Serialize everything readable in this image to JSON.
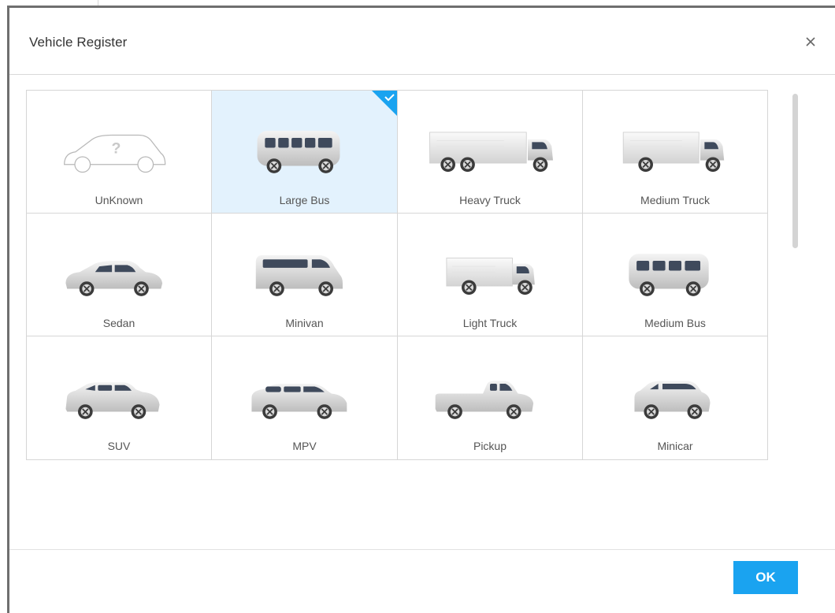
{
  "dialog": {
    "title": "Vehicle Register",
    "close_icon": "close-icon",
    "ok_label": "OK",
    "accent": "#1aa3f0",
    "selected_bg": "#e3f2fd"
  },
  "vehicles": [
    {
      "label": "UnKnown",
      "icon": "unknown-car-icon",
      "selected": false
    },
    {
      "label": "Large Bus",
      "icon": "large-bus-icon",
      "selected": true
    },
    {
      "label": "Heavy Truck",
      "icon": "heavy-truck-icon",
      "selected": false
    },
    {
      "label": "Medium Truck",
      "icon": "medium-truck-icon",
      "selected": false
    },
    {
      "label": "Sedan",
      "icon": "sedan-icon",
      "selected": false
    },
    {
      "label": "Minivan",
      "icon": "minivan-icon",
      "selected": false
    },
    {
      "label": "Light Truck",
      "icon": "light-truck-icon",
      "selected": false
    },
    {
      "label": "Medium Bus",
      "icon": "medium-bus-icon",
      "selected": false
    },
    {
      "label": "SUV",
      "icon": "suv-icon",
      "selected": false
    },
    {
      "label": "MPV",
      "icon": "mpv-icon",
      "selected": false
    },
    {
      "label": "Pickup",
      "icon": "pickup-icon",
      "selected": false
    },
    {
      "label": "Minicar",
      "icon": "minicar-icon",
      "selected": false
    }
  ]
}
